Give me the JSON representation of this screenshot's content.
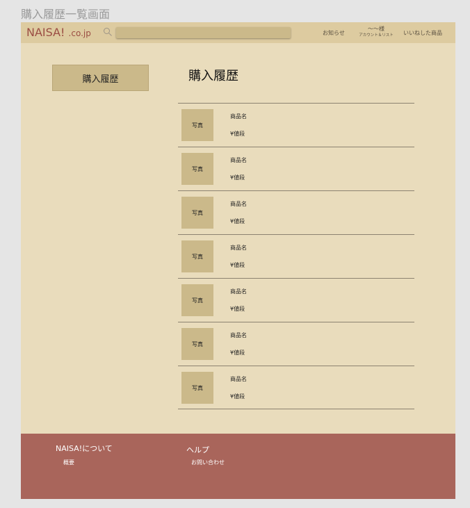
{
  "frame_title": "購入履歴一覧画面",
  "header": {
    "logo_main": "NAISA!",
    "logo_sub": ".co.jp",
    "search_placeholder": "",
    "notice_label": "お知らせ",
    "account_name": "〜〜様",
    "account_sub": "アカウント＆リスト",
    "liked_label": "いいねした商品"
  },
  "sidebar": {
    "button_label": "購入履歴"
  },
  "main": {
    "title": "購入履歴",
    "items": [
      {
        "photo": "写真",
        "name": "商品名",
        "price": "¥値段"
      },
      {
        "photo": "写真",
        "name": "商品名",
        "price": "¥値段"
      },
      {
        "photo": "写真",
        "name": "商品名",
        "price": "¥値段"
      },
      {
        "photo": "写真",
        "name": "商品名",
        "price": "¥値段"
      },
      {
        "photo": "写真",
        "name": "商品名",
        "price": "¥値段"
      },
      {
        "photo": "写真",
        "name": "商品名",
        "price": "¥値段"
      },
      {
        "photo": "写真",
        "name": "商品名",
        "price": "¥値段"
      }
    ]
  },
  "footer": {
    "about_title": "NAISA!について",
    "about_link": "概要",
    "help_title": "ヘルプ",
    "help_link": "お問い合わせ"
  },
  "colors": {
    "page_bg": "#e9dcbc",
    "header_bg": "#ddcba0",
    "accent_tan": "#cbb98a",
    "logo": "#9b4d43",
    "footer_bg": "#a9655b"
  }
}
